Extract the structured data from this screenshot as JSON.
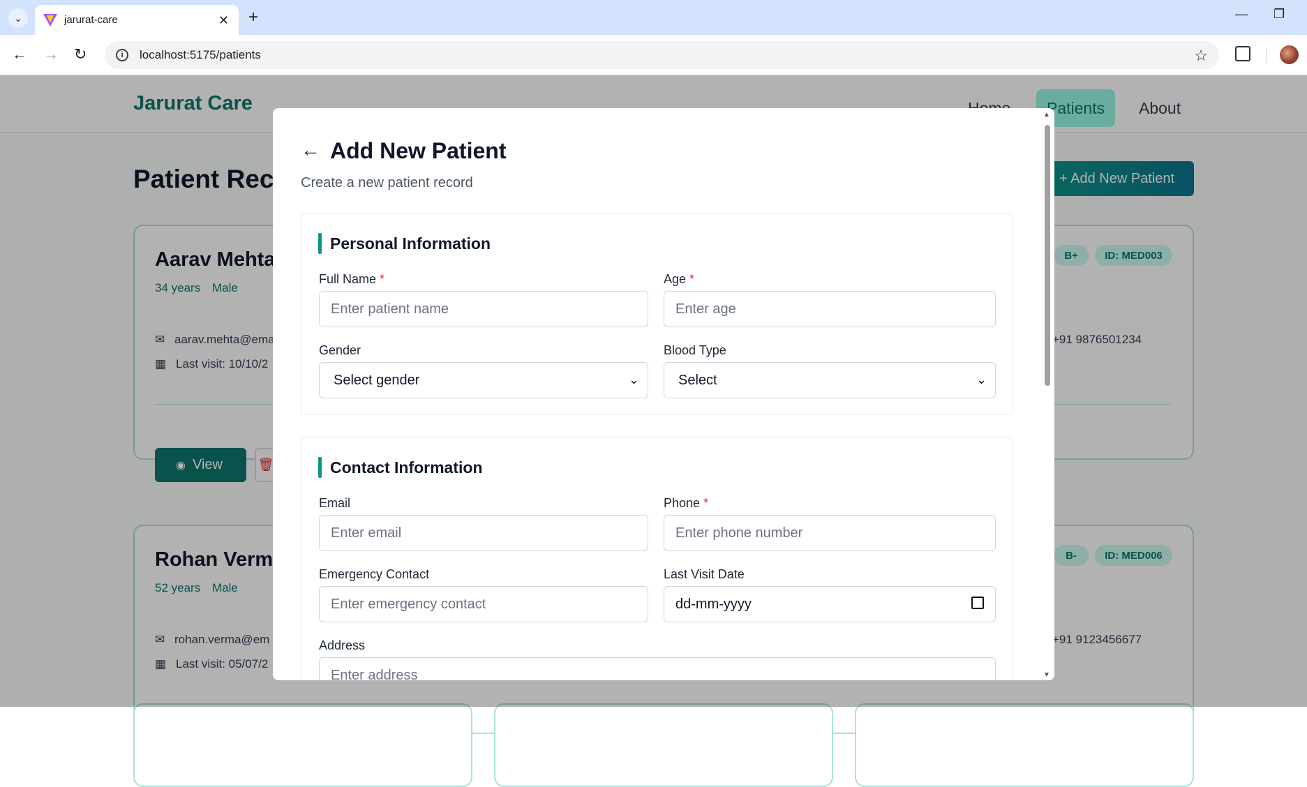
{
  "browser": {
    "tab_title": "jarurat-care",
    "url": "localhost:5175/patients",
    "new_tab": "+",
    "close": "✕"
  },
  "app": {
    "brand": "Jarurat Care",
    "nav": [
      {
        "label": "Home"
      },
      {
        "label": "Patients"
      },
      {
        "label": "About"
      }
    ],
    "page_title": "Patient Rec",
    "add_button": "+ Add New Patient",
    "patients": [
      {
        "name": "Aarav Mehta",
        "age": "34 years",
        "gender": "Male",
        "email": "aarav.mehta@ema",
        "last_visit": "Last visit: 10/10/2",
        "blood": "B+",
        "id": "ID: MED003",
        "phone": "+91 9876501234",
        "view": "View"
      },
      {
        "name": "Rohan Verm",
        "age": "52 years",
        "gender": "Male",
        "email": "rohan.verma@em",
        "last_visit": "Last visit: 05/07/2",
        "blood": "B-",
        "id": "ID: MED006",
        "phone": "+91 9123456677"
      }
    ]
  },
  "modal": {
    "title": "Add New Patient",
    "subtitle": "Create a new patient record",
    "personal": {
      "title": "Personal Information",
      "full_name_label": "Full Name",
      "full_name_placeholder": "Enter patient name",
      "age_label": "Age",
      "age_placeholder": "Enter age",
      "gender_label": "Gender",
      "gender_value": "Select gender",
      "blood_label": "Blood Type",
      "blood_value": "Select"
    },
    "contact": {
      "title": "Contact Information",
      "email_label": "Email",
      "email_placeholder": "Enter email",
      "phone_label": "Phone",
      "phone_placeholder": "Enter phone number",
      "emergency_label": "Emergency Contact",
      "emergency_placeholder": "Enter emergency contact",
      "visit_label": "Last Visit Date",
      "visit_value": "dd-mm-yyyy",
      "address_label": "Address",
      "address_placeholder": "Enter address"
    },
    "required_mark": "*"
  },
  "colors": {
    "accent": "#0d9488",
    "brand": "#0f766e",
    "danger": "#dc2626"
  }
}
